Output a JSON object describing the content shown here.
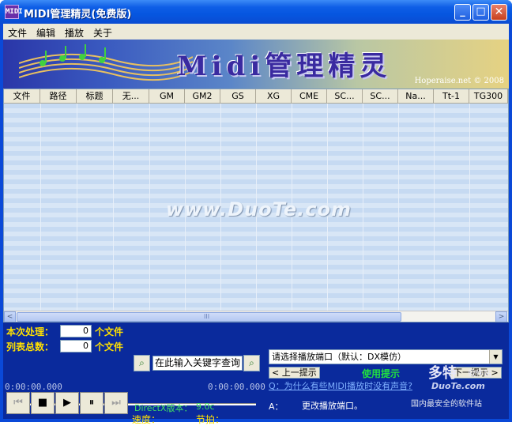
{
  "window": {
    "title": "MIDI管理精灵(免费版)",
    "icon_text": "MIDI",
    "minimize_glyph": "_",
    "maximize_glyph": "□",
    "close_glyph": "✕"
  },
  "menu": [
    "文件",
    "编辑",
    "播放",
    "关于"
  ],
  "banner": {
    "title": "Midi管理精灵",
    "copyright": "Hoperaise.net © 2008"
  },
  "table": {
    "columns": [
      "文件",
      "路径",
      "标题",
      "无...",
      "GM",
      "GM2",
      "GS",
      "XG",
      "CME",
      "SC...",
      "SC...",
      "Na...",
      "Tt-1",
      "TG300"
    ],
    "watermark": "www.DuoTe.com"
  },
  "scrollbar": {
    "left": "<",
    "right": ">",
    "thumb": "III"
  },
  "panel": {
    "processed_label": "本次处理：",
    "processed_value": "0",
    "processed_unit": "个文件",
    "total_label": "列表总数：",
    "total_value": "0",
    "total_unit": "个文件",
    "search_placeholder": "在此输入关键字查询",
    "port_select": "请选择播放端口（默认：DX模仿）",
    "prev_hint": "< 上一提示",
    "usage_hint": "使用提示",
    "next_hint": "下一提示 >",
    "question": "Q：为什么有些MIDI播放时没有声音?",
    "answer_prefix": "A：",
    "answer": "更改播放端口。",
    "time_start": "0:00:00.000",
    "time_end": "0:00:00.000",
    "speed_label": "速度：",
    "beat_label": "节拍：",
    "directx_label": "DirectX版本：",
    "directx_value": "9.0c"
  },
  "transport": {
    "first": "⏮",
    "stop": "■",
    "play": "▶",
    "pause": "⏸",
    "last": "⏭"
  },
  "logo": {
    "big": "多特",
    "small": "软件站",
    "url": "DuoTe.com",
    "tag": "国内最安全的软件站"
  }
}
